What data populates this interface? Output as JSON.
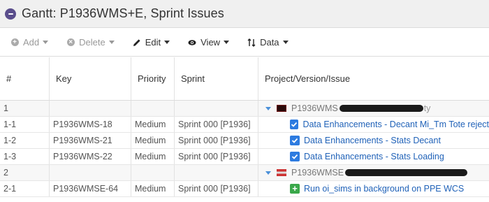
{
  "title": "Gantt:  P1936WMS+E, Sprint Issues",
  "toolbar": {
    "add": "Add",
    "delete": "Delete",
    "edit": "Edit",
    "view": "View",
    "data": "Data"
  },
  "columns": {
    "num": "#",
    "key": "Key",
    "priority": "Priority",
    "sprint": "Sprint",
    "project": "Project/Version/Issue"
  },
  "rows": [
    {
      "num": "1",
      "key": "",
      "priority": "",
      "sprint": "",
      "project_prefix": "P1936WMS",
      "project_tail": "ty",
      "kind": "parent",
      "img": "img1"
    },
    {
      "num": "1-1",
      "key": "P1936WMS-18",
      "priority": "Medium",
      "sprint": "Sprint 000 [P1936]",
      "issue": "Data Enhancements - Decant Mi_Tm Tote reject",
      "kind": "task"
    },
    {
      "num": "1-2",
      "key": "P1936WMS-21",
      "priority": "Medium",
      "sprint": "Sprint 000 [P1936]",
      "issue": "Data Enhancements - Stats Decant",
      "kind": "task"
    },
    {
      "num": "1-3",
      "key": "P1936WMS-22",
      "priority": "Medium",
      "sprint": "Sprint 000 [P1936]",
      "issue": "Data Enhancements - Stats Loading",
      "kind": "task"
    },
    {
      "num": "2",
      "key": "",
      "priority": "",
      "sprint": "",
      "project_prefix": "P1936WMSE",
      "project_tail": "",
      "kind": "parent",
      "img": "img2"
    },
    {
      "num": "2-1",
      "key": "P1936WMSE-64",
      "priority": "Medium",
      "sprint": "Sprint 000 [P1936]",
      "issue": "Run oi_sims in background on PPE WCS",
      "kind": "new"
    }
  ]
}
